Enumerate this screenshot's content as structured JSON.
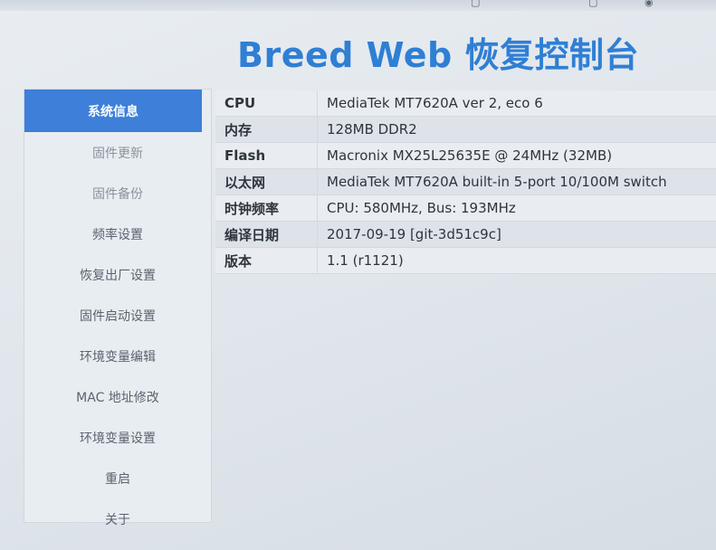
{
  "app": {
    "title": "Breed Web 恢复控制台"
  },
  "sidebar": {
    "items": [
      {
        "label": "系统信息",
        "active": true
      },
      {
        "label": "固件更新"
      },
      {
        "label": "固件备份"
      },
      {
        "label": "频率设置"
      },
      {
        "label": "恢复出厂设置"
      },
      {
        "label": "固件启动设置"
      },
      {
        "label": "环境变量编辑"
      },
      {
        "label": "MAC 地址修改"
      },
      {
        "label": "环境变量设置"
      },
      {
        "label": "重启"
      },
      {
        "label": "关于"
      }
    ]
  },
  "info": {
    "rows": [
      {
        "key": "CPU",
        "value": "MediaTek MT7620A ver 2, eco 6"
      },
      {
        "key": "内存",
        "value": "128MB DDR2"
      },
      {
        "key": "Flash",
        "value": "Macronix MX25L25635E @ 24MHz (32MB)"
      },
      {
        "key": "以太网",
        "value": "MediaTek MT7620A built-in 5-port 10/100M switch"
      },
      {
        "key": "时钟频率",
        "value": "CPU: 580MHz, Bus: 193MHz"
      },
      {
        "key": "编译日期",
        "value": "2017-09-19 [git-3d51c9c]"
      },
      {
        "key": "版本",
        "value": "1.1 (r1121)"
      }
    ]
  },
  "colors": {
    "accent": "#3d7fd9",
    "title": "#2f7fd4"
  }
}
